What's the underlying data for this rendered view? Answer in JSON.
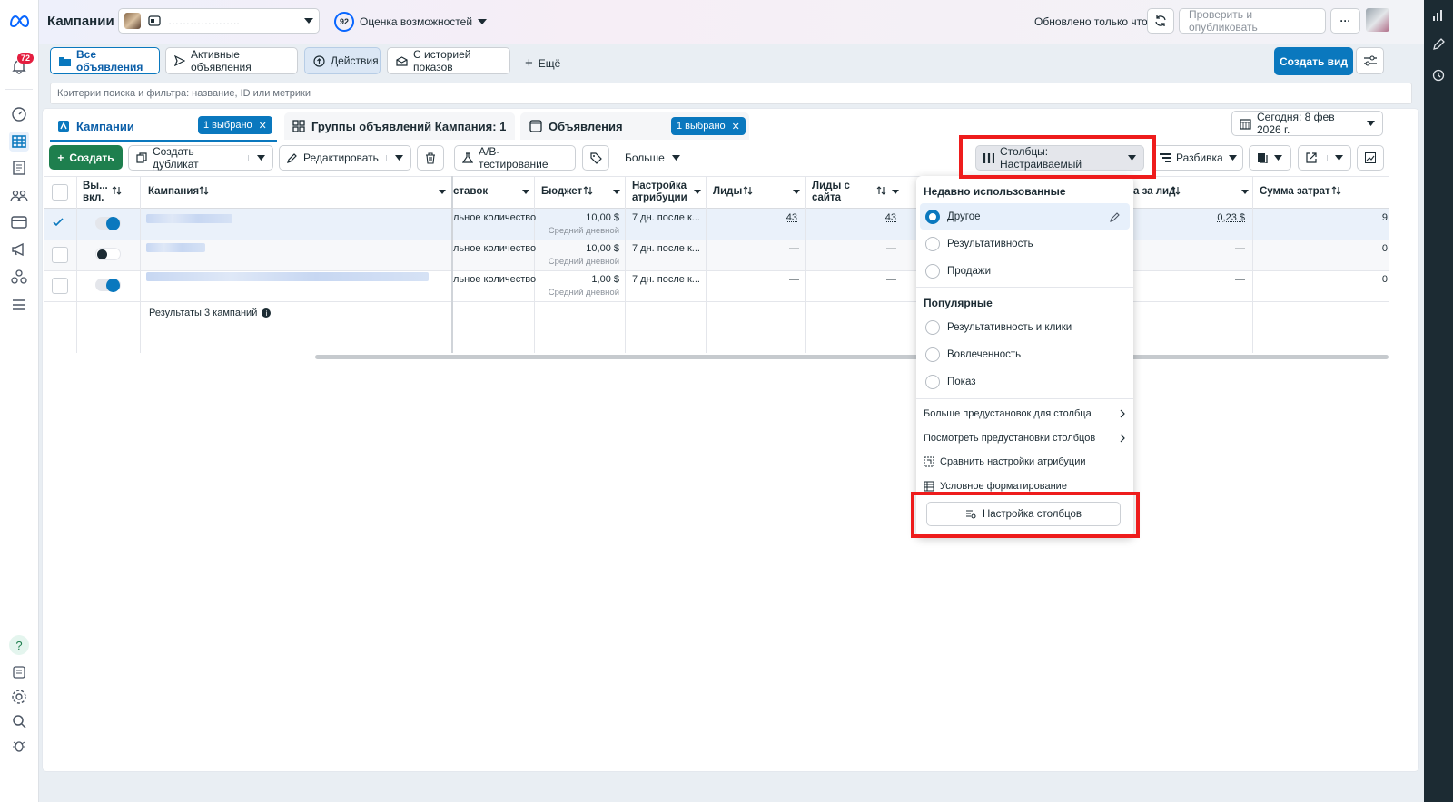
{
  "colors": {
    "accent": "#0a78be",
    "highlight": "#ee1c1c",
    "create_green": "#1e7f4e"
  },
  "header": {
    "title": "Кампании",
    "account": "………………..",
    "score": "92",
    "opportunity": "Оценка возможностей",
    "updated": "Обновлено только что",
    "publish": "Проверить и опубликовать",
    "more": "···"
  },
  "notifications": {
    "count": "72"
  },
  "tabs": {
    "all": "Все объявления",
    "active": "Активные объявления",
    "actions": "Действия",
    "history": "С историей показов",
    "more": "Ещё",
    "create_view": "Создать вид"
  },
  "search": {
    "placeholder": "Критерии поиска и фильтра: название, ID или метрики"
  },
  "levels": {
    "campaigns": "Кампании",
    "campaigns_sel": "1 выбрано",
    "adsets": "Группы объявлений Кампания: 1",
    "ads": "Объявления",
    "ads_sel": "1 выбрано",
    "date": "Сегодня: 8 фев 2026 г."
  },
  "toolbar": {
    "create": "Создать",
    "duplicate": "Создать дубликат",
    "edit": "Редактировать",
    "ab": "A/B-тестирование",
    "more": "Больше",
    "columns": "Столбцы: Настраиваемый",
    "breakdown": "Разбивка"
  },
  "table": {
    "headers": {
      "toggle": "Вы... вкл.",
      "campaign": "Кампания",
      "bid": "ставок",
      "budget": "Бюджет",
      "attribution": "Настройка атрибуции",
      "leads": "Лиды",
      "site_leads": "Лиды с сайта",
      "per_lead": "а за лид",
      "spend": "Сумма затрат"
    },
    "rows": [
      {
        "bid": "льное количество",
        "budget": "10,00 $",
        "budget_sub": "Средний дневной",
        "attr": "7 дн. после к...",
        "leads": "43",
        "site": "43",
        "cpl": "0,23 $",
        "spend": "9"
      },
      {
        "bid": "льное количество",
        "budget": "10,00 $",
        "budget_sub": "Средний дневной",
        "attr": "7 дн. после к...",
        "leads": "—",
        "site": "—",
        "cpl": "—",
        "spend": "0"
      },
      {
        "bid": "льное количество",
        "budget": "1,00 $",
        "budget_sub": "Средний дневной",
        "attr": "7 дн. после к...",
        "leads": "—",
        "site": "—",
        "cpl": "—",
        "spend": "0"
      }
    ],
    "footer": "Результаты 3 кампаний"
  },
  "dropdown": {
    "recent_title": "Недавно использованные",
    "recent": [
      "Другое",
      "Результативность",
      "Продажи"
    ],
    "popular_title": "Популярные",
    "popular": [
      "Результативность и клики",
      "Вовлеченность",
      "Показ"
    ],
    "links": [
      "Больше предустановок для столбца",
      "Посмотреть предустановки столбцов",
      "Сравнить настройки атрибуции",
      "Условное форматирование"
    ],
    "customize": "Настройка столбцов"
  }
}
